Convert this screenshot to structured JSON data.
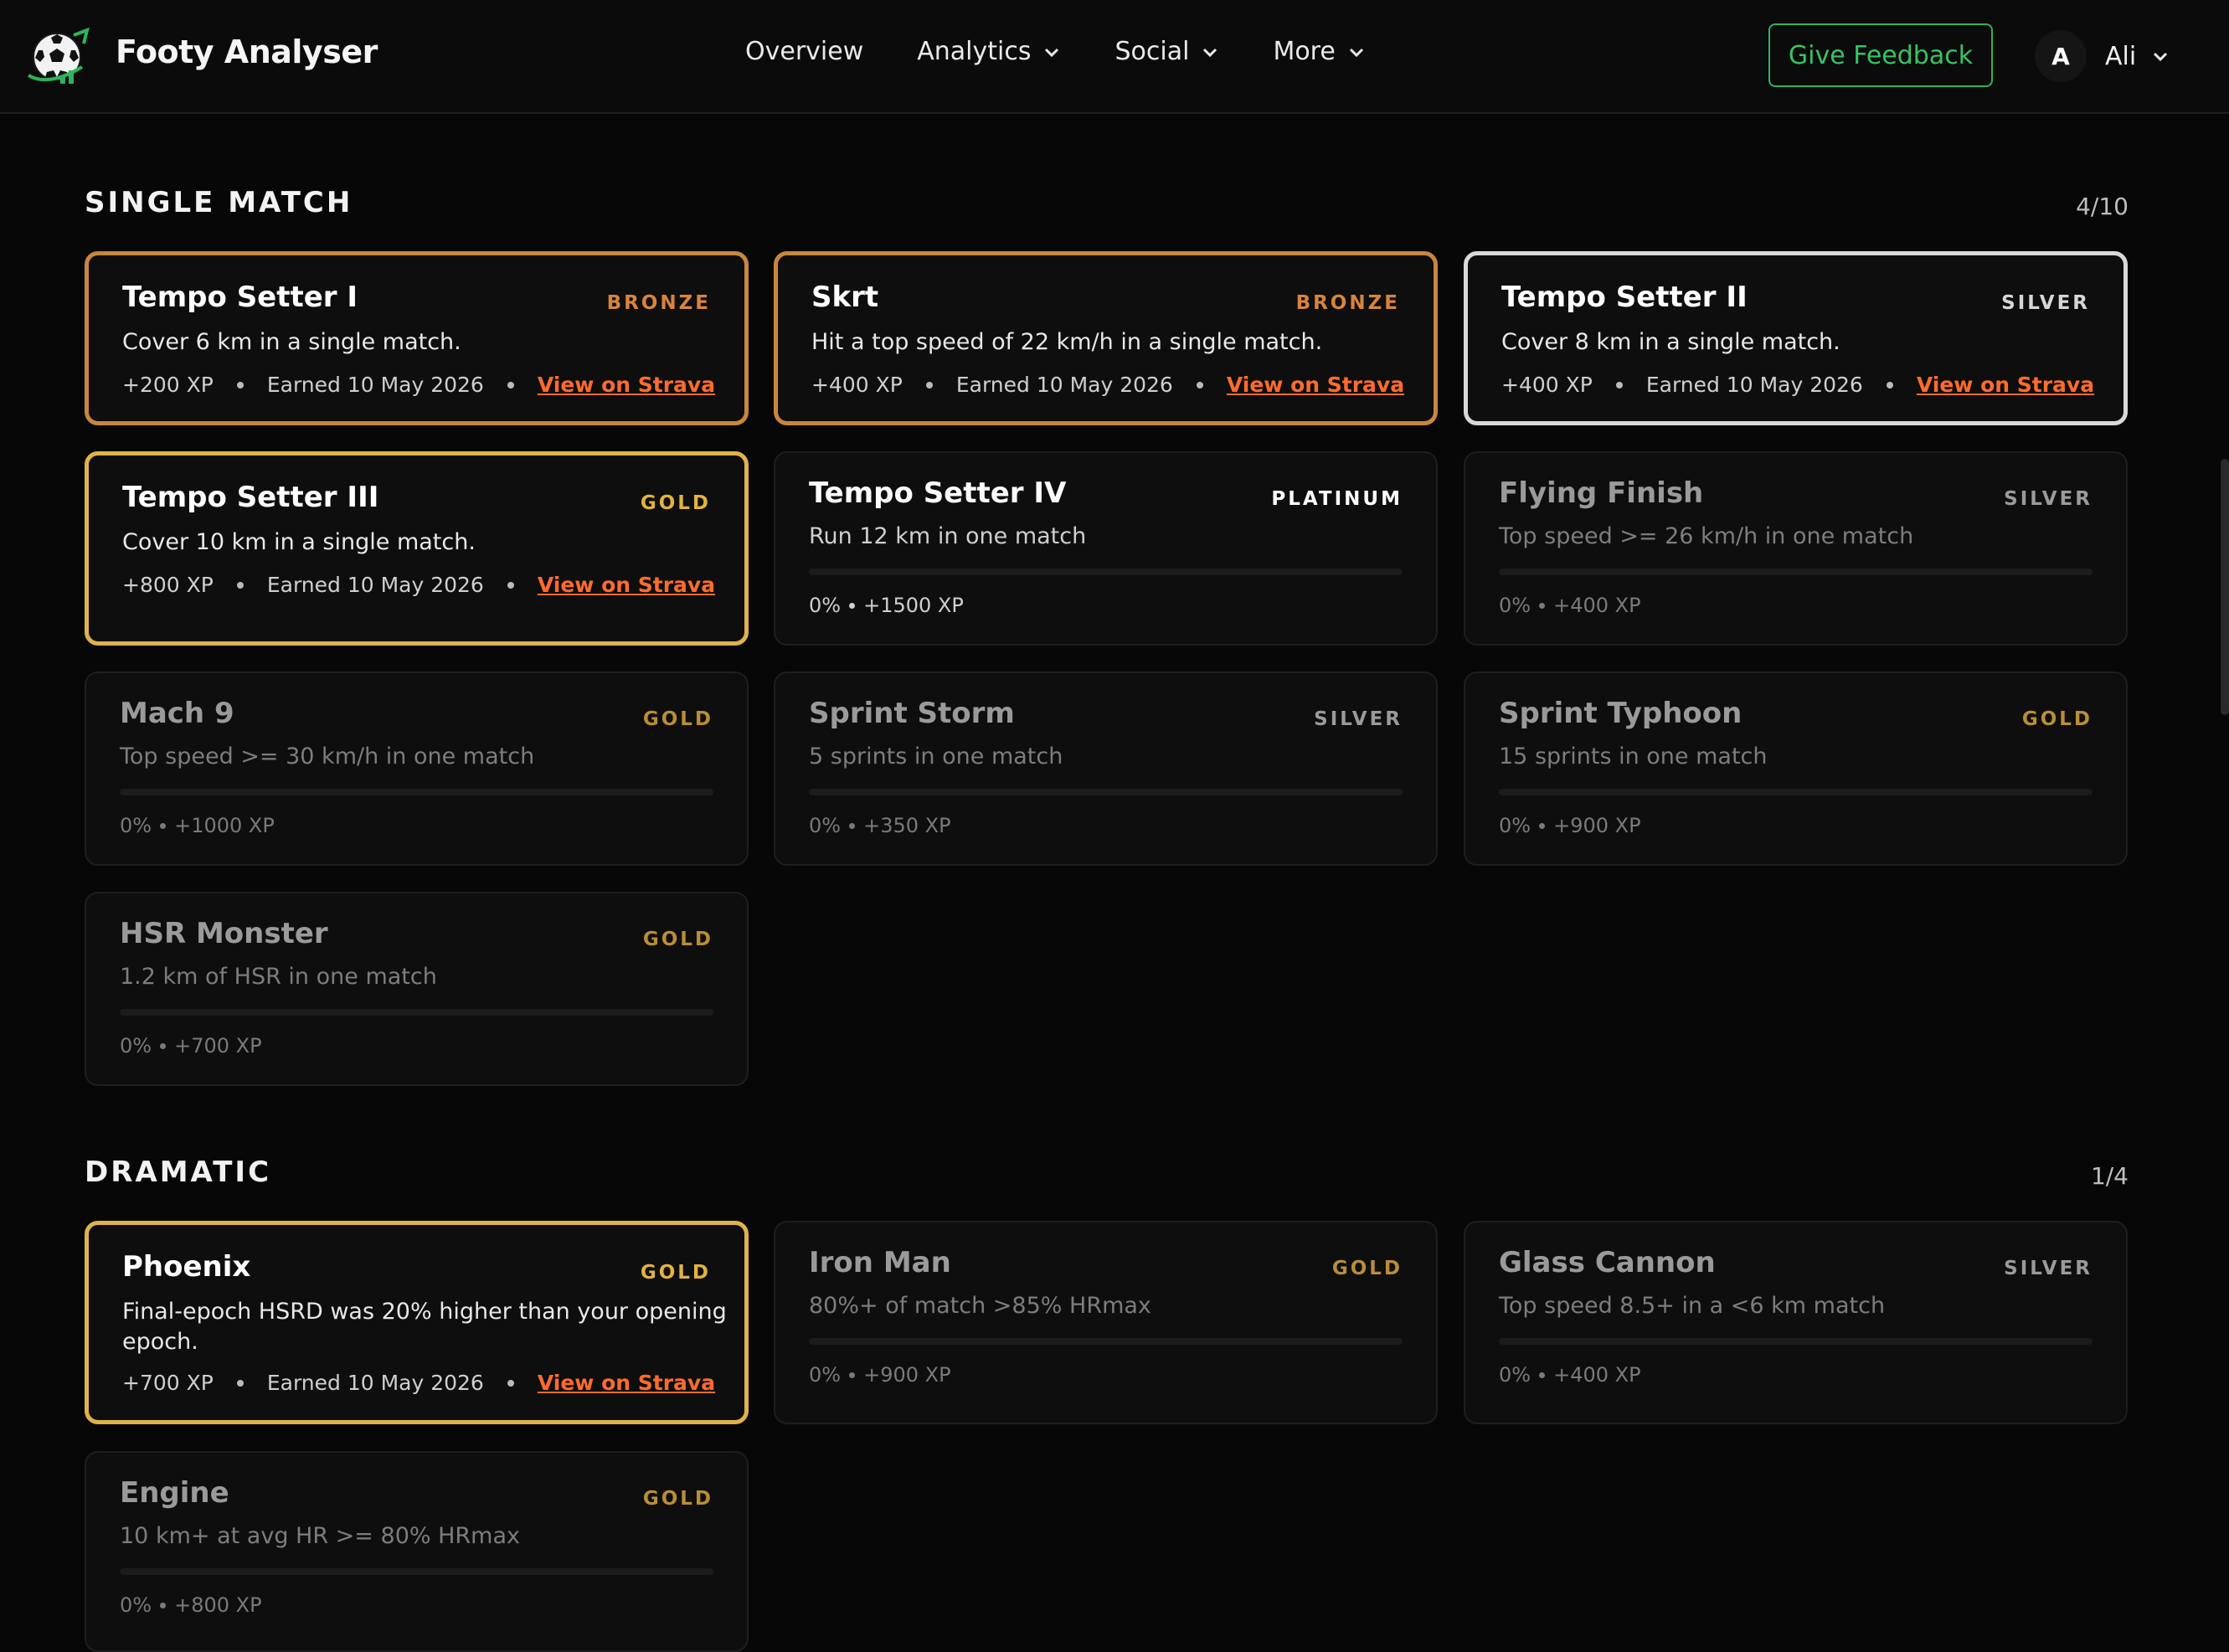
{
  "header": {
    "brand": "Footy Analyser",
    "nav": [
      "Overview",
      "Analytics",
      "Social",
      "More"
    ],
    "feedback_label": "Give Feedback",
    "user_initial": "A",
    "user_name": "Ali"
  },
  "sections": [
    {
      "title": "SINGLE MATCH",
      "count": "4/10",
      "cards": [
        {
          "name": "Tempo Setter I",
          "tier": "BRONZE",
          "desc": "Cover 6 km in a single match.",
          "xp": "+200 XP",
          "earned": "Earned 10 May 2026",
          "link": "View on Strava"
        },
        {
          "name": "Skrt",
          "tier": "BRONZE",
          "desc": "Hit a top speed of 22 km/h in a single match.",
          "xp": "+400 XP",
          "earned": "Earned 10 May 2026",
          "link": "View on Strava"
        },
        {
          "name": "Tempo Setter II",
          "tier": "SILVER",
          "desc": "Cover 8 km in a single match.",
          "xp": "+400 XP",
          "earned": "Earned 10 May 2026",
          "link": "View on Strava"
        },
        {
          "name": "Tempo Setter III",
          "tier": "GOLD",
          "desc": "Cover 10 km in a single match.",
          "xp": "+800 XP",
          "earned": "Earned 10 May 2026",
          "link": "View on Strava"
        },
        {
          "name": "Tempo Setter IV",
          "tier": "PLATINUM",
          "desc": "Run 12 km in one match",
          "progress_pct": "0%",
          "xp": "+1500 XP",
          "progress": 0
        },
        {
          "name": "Flying Finish",
          "tier": "SILVER",
          "desc": "Top speed >= 26 km/h in one match",
          "progress_pct": "0%",
          "xp": "+400 XP",
          "progress": 0
        },
        {
          "name": "Mach 9",
          "tier": "GOLD",
          "desc": "Top speed >= 30 km/h in one match",
          "progress_pct": "0%",
          "xp": "+1000 XP",
          "progress": 0
        },
        {
          "name": "Sprint Storm",
          "tier": "SILVER",
          "desc": "5 sprints in one match",
          "progress_pct": "0%",
          "xp": "+350 XP",
          "progress": 0
        },
        {
          "name": "Sprint Typhoon",
          "tier": "GOLD",
          "desc": "15 sprints in one match",
          "progress_pct": "0%",
          "xp": "+900 XP",
          "progress": 0
        },
        {
          "name": "HSR Monster",
          "tier": "GOLD",
          "desc": "1.2 km of HSR in one match",
          "progress_pct": "0%",
          "xp": "+700 XP",
          "progress": 0
        }
      ]
    },
    {
      "title": "DRAMATIC",
      "count": "1/4",
      "cards": [
        {
          "name": "Phoenix",
          "tier": "GOLD",
          "desc": "Final-epoch HSRD was 20% higher than your opening epoch.",
          "xp": "+700 XP",
          "earned": "Earned 10 May 2026",
          "link": "View on Strava"
        },
        {
          "name": "Iron Man",
          "tier": "GOLD",
          "desc": "80%+ of match >85% HRmax",
          "progress_pct": "0%",
          "xp": "+900 XP",
          "progress": 0
        },
        {
          "name": "Glass Cannon",
          "tier": "SILVER",
          "desc": "Top speed 8.5+ in a <6 km match",
          "progress_pct": "0%",
          "xp": "+400 XP",
          "progress": 0
        },
        {
          "name": "Engine",
          "tier": "GOLD",
          "desc": "10 km+ at avg HR >= 80% HRmax",
          "progress_pct": "0%",
          "xp": "+800 XP",
          "progress": 0
        }
      ]
    }
  ]
}
